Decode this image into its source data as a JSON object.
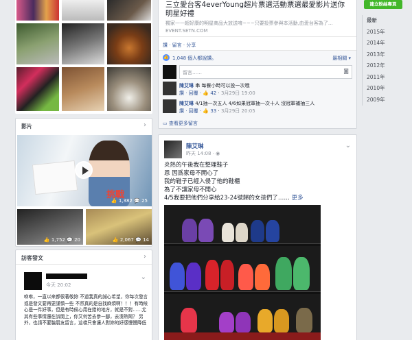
{
  "photos": {},
  "videos": {
    "title": "影片",
    "main_caption": "挑戰",
    "main_count": "1,382",
    "main_comments": "25",
    "sub1_count": "1,752",
    "sub1_comments": "20",
    "sub2_count": "2,067",
    "sub2_comments": "14"
  },
  "visitor_posts": {
    "title": "訪客發文",
    "author": "",
    "time": "今天 20:02",
    "text": "咻咻，一直以來都很著敬妳 不過我真的誠心希望，你每次發言或是發文要再更謹慎一些 不然真的是自找麻煩啊！！！有時候心是一件好事，但是有時候心用在錯的地方，就是不對……尤其有些事情還在訴閱上，你又何苦去參一腳，去湊熱鬧？ 另外，也請不要騙朋友留言，這樣只會讓人對妳的好感慢慢降低"
  },
  "link_post": {
    "headline": "三立愛台客4everYoung超片票選活動票選最愛影片送你明星好禮",
    "desc": "獨家一一超好康的明星商品大放送唷~~~只要投票參與本活動,由愛台客為了…",
    "domain": "EVENT.SETN.COM",
    "actions": "讚 · 留言 · 分享",
    "likes": "1,048 個人都說讚。",
    "sort": "最相關",
    "comment_placeholder": "留言……",
    "comments": [
      {
        "name": "陳艾琳",
        "text": "串 每餐小時可以投一次哦",
        "actions": "讚 · 回覆 ·",
        "likes": "42",
        "time": "3月29日 19:00"
      },
      {
        "name": "陳艾琳",
        "text": "4/1抽一次五人 4/6如果冠軍抽一次十人 沒冠軍補抽三人",
        "actions": "讚 · 回覆 ·",
        "likes": "33",
        "time": "3月29日 20:05"
      }
    ],
    "more": "查看更多留言"
  },
  "shoe_post": {
    "author": "陳艾琳",
    "time": "昨天 14:08 · ",
    "lines": [
      "炎熱的午後我在整理鞋子",
      "恩 因爲家母不開心了",
      "我的鞋子已經入侵了他的鞋櫃",
      "為了不讓家母不開心",
      "4/5我要把他們分享給23-24號歸的女孩們了……"
    ],
    "more": "更多"
  },
  "sidebar": {
    "create_button": "建立粉絲專頁",
    "years": [
      "最新",
      "2015年",
      "2014年",
      "2013年",
      "2012年",
      "2011年",
      "2010年",
      "2009年"
    ]
  }
}
